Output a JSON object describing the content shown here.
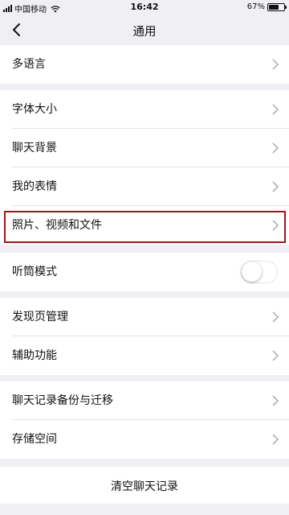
{
  "status_bar": {
    "carrier": "中国移动",
    "time": "16:42",
    "battery_percent": "67%",
    "battery_level": 0.67
  },
  "nav": {
    "title": "通用",
    "back_icon": "chevron-left-icon"
  },
  "items": [
    {
      "label": "多语言",
      "type": "link"
    },
    {
      "label": "字体大小",
      "type": "link"
    },
    {
      "label": "聊天背景",
      "type": "link"
    },
    {
      "label": "我的表情",
      "type": "link"
    },
    {
      "label": "照片、视频和文件",
      "type": "link",
      "highlighted": true
    },
    {
      "label": "听筒模式",
      "type": "toggle",
      "on": false
    },
    {
      "label": "发现页管理",
      "type": "link"
    },
    {
      "label": "辅助功能",
      "type": "link"
    },
    {
      "label": "聊天记录备份与迁移",
      "type": "link"
    },
    {
      "label": "存储空间",
      "type": "link"
    }
  ],
  "clear_chat": "清空聊天记录",
  "colors": {
    "background": "#efeff4",
    "highlight_border": "#a1151b",
    "chevron": "#b2b2b2"
  }
}
